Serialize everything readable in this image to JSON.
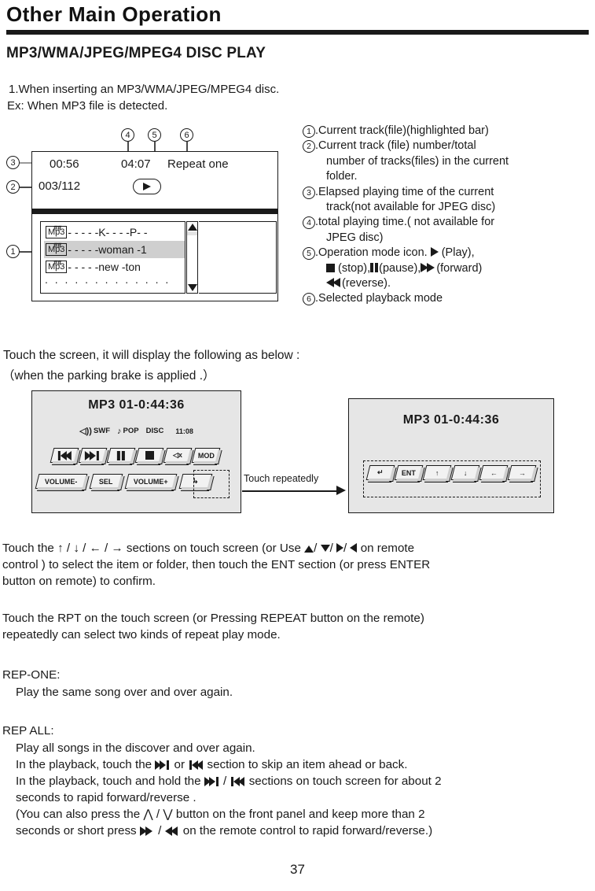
{
  "header": {
    "title": "Other Main Operation",
    "section_title": "MP3/WMA/JPEG/MPEG4 DISC PLAY",
    "intro_line1": "1.When inserting an MP3/WMA/JPEG/MPEG4 disc.",
    "intro_line2": "Ex: When MP3 file is detected."
  },
  "callouts": {
    "n1": "1",
    "n2": "2",
    "n3": "3",
    "n4": "4",
    "n5": "5",
    "n6": "6"
  },
  "lcd_mock": {
    "elapsed_time": "00:56",
    "total_time": "04:07",
    "playback_mode": "Repeat one",
    "track_number": "003/112",
    "play_icon": "play-triangle-icon",
    "files": [
      {
        "chip": "Mp3",
        "sharp": "##",
        "name": "- - - - -K- - - -P- -",
        "selected": false
      },
      {
        "chip": "Mp3",
        "sharp": "##",
        "name": "- - - - -woman  -1",
        "selected": true
      },
      {
        "chip": "Mp3",
        "sharp": "##",
        "name": "- - - - -new -ton",
        "selected": false
      }
    ],
    "more_dots": ". . . . . . . . . . . . ."
  },
  "legend": [
    {
      "num": "1",
      "text": ".Current track(file)(highlighted bar)",
      "cont": []
    },
    {
      "num": "2",
      "text": ".Current track (file) number/total",
      "cont": [
        "number of tracks(files) in the current",
        "folder."
      ]
    },
    {
      "num": "3",
      "text": ".Elapsed playing time of the current",
      "cont": [
        "track(not available for JPEG disc)"
      ]
    },
    {
      "num": "4",
      "text": ".total playing time.( not available for",
      "cont": [
        "JPEG disc)"
      ]
    },
    {
      "num": "5",
      "text_pre": ".Operation mode icon.  ",
      "text_play": " (Play),",
      "line2_stop": " (stop),",
      "line2_pause": "(pause),",
      "line2_fwd": "(forward)",
      "line3_rev": "(reverse)."
    },
    {
      "num": "6",
      "text": ".Selected playback mode",
      "cont": []
    }
  ],
  "mid_text": {
    "line1": "Touch the screen, it will display the following as below :",
    "line2": "（when the parking brake is applied .）"
  },
  "panel_left": {
    "title": "MP3   01-0:44:36",
    "status": {
      "speaker_icon": "speaker-icon",
      "swf_label": "SWF",
      "note_icon": "music-note-icon",
      "pop_label": "POP",
      "disc_label": "DISC",
      "clock": "11:08"
    },
    "row1_keys": [
      {
        "name": "skip-prev-key",
        "glyph": "skip-prev-icon",
        "label": ""
      },
      {
        "name": "skip-next-key",
        "glyph": "skip-next-icon",
        "label": ""
      },
      {
        "name": "pause-key",
        "glyph": "pause-icon",
        "label": ""
      },
      {
        "name": "stop-key",
        "glyph": "stop-icon",
        "label": ""
      },
      {
        "name": "mute-key",
        "glyph": "mute-icon",
        "label": ""
      },
      {
        "name": "mode-key",
        "glyph": "",
        "label": "MOD"
      }
    ],
    "row2_keys": [
      {
        "name": "volume-down-key",
        "glyph": "",
        "label": "VOLUME-"
      },
      {
        "name": "select-key",
        "glyph": "",
        "label": "SEL"
      },
      {
        "name": "volume-up-key",
        "glyph": "",
        "label": "VOLUME+"
      },
      {
        "name": "next-page-key",
        "glyph": "enter-arrow-icon",
        "label": ""
      }
    ]
  },
  "panel_right": {
    "title": "MP3   01-0:44:36",
    "keys": [
      {
        "name": "return-key",
        "glyph": "return-arrow-icon",
        "label": ""
      },
      {
        "name": "enter-key",
        "glyph": "",
        "label": "ENT"
      },
      {
        "name": "up-key",
        "glyph": "arrow-up-icon",
        "label": ""
      },
      {
        "name": "down-key",
        "glyph": "arrow-down-icon",
        "label": ""
      },
      {
        "name": "left-key",
        "glyph": "arrow-left-icon",
        "label": ""
      },
      {
        "name": "right-key",
        "glyph": "arrow-right-icon",
        "label": ""
      }
    ]
  },
  "touch_annotation": "Touch repeatedly",
  "body": {
    "nav_pre": "Touch the ",
    "nav_mid": "  sections on touch screen (or Use ",
    "nav_post": " on remote",
    "nav_line2": "control ) to select the item or folder, then touch the ENT section (or press ENTER",
    "nav_line3": "button on remote) to confirm.",
    "rpt_line1": "Touch the RPT on the touch screen (or Pressing REPEAT button on the remote)",
    "rpt_line2": "repeatedly can select two kinds of repeat play mode.",
    "rep_one_head": "REP-ONE:",
    "rep_one_body": "Play the same song over and over again.",
    "rep_all_head": "REP ALL:",
    "rep_all_l1": "Play all songs in the discover and over again.",
    "rep_all_l2_pre": "In the playback, touch the  ",
    "rep_all_l2_mid": " or ",
    "rep_all_l2_post": " section to skip an item ahead or back.",
    "rep_all_l3_pre": "In the playback, touch and hold the ",
    "rep_all_l3_mid": " / ",
    "rep_all_l3_post": " sections on touch screen for about 2",
    "rep_all_l4": "seconds to rapid forward/reverse .",
    "rep_all_l5_pre": "(You can also press the ",
    "rep_all_l5_mid": " / ",
    "rep_all_l5_post": " button on the front panel and keep more than 2",
    "rep_all_l6_pre": "seconds  or short press  ",
    "rep_all_l6_mid": " / ",
    "rep_all_l6_post": " on the remote control to rapid forward/reverse.)"
  },
  "page_number": "37",
  "colors": {
    "ink": "#1a1a1a",
    "panel_bg": "#e6e6e6",
    "highlight": "#cfcfcf"
  }
}
